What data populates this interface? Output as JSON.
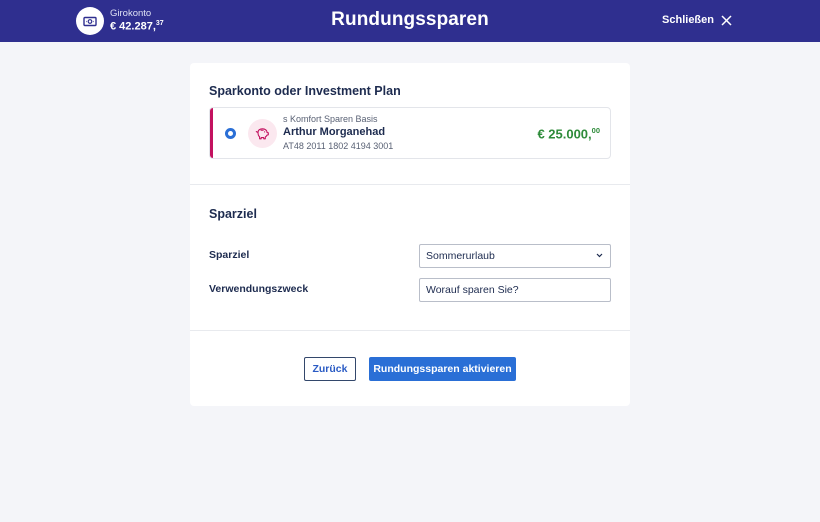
{
  "header": {
    "account_name": "Girokonto",
    "account_balance_main": "€ 42.287,",
    "account_balance_cents": "37",
    "title": "Rundungssparen",
    "close_label": "Schließen"
  },
  "account_section": {
    "title": "Sparkonto oder Investment Plan",
    "selected_account": {
      "product": "s Komfort Sparen Basis",
      "holder": "Arthur Morganehad",
      "iban": "AT48 2011 1802 4194 3001",
      "amount_main": "€ 25.000,",
      "amount_cents": "00",
      "selected": true
    }
  },
  "goal_section": {
    "title": "Sparziel",
    "goal_label": "Sparziel",
    "goal_value": "Sommerurlaub",
    "purpose_label": "Verwendungszweck",
    "purpose_placeholder": "Worauf sparen Sie?"
  },
  "actions": {
    "back_label": "Zurück",
    "activate_label": "Rundungssparen aktivieren"
  },
  "colors": {
    "header_bg": "#2f2f8f",
    "accent_blue": "#2a6fd6",
    "account_marker": "#c3115f",
    "amount_green": "#2e8b3a"
  },
  "icons": {
    "account": "banknote-icon",
    "close": "close-icon",
    "savings": "piggy-bank-icon",
    "dropdown": "chevron-down-icon"
  }
}
